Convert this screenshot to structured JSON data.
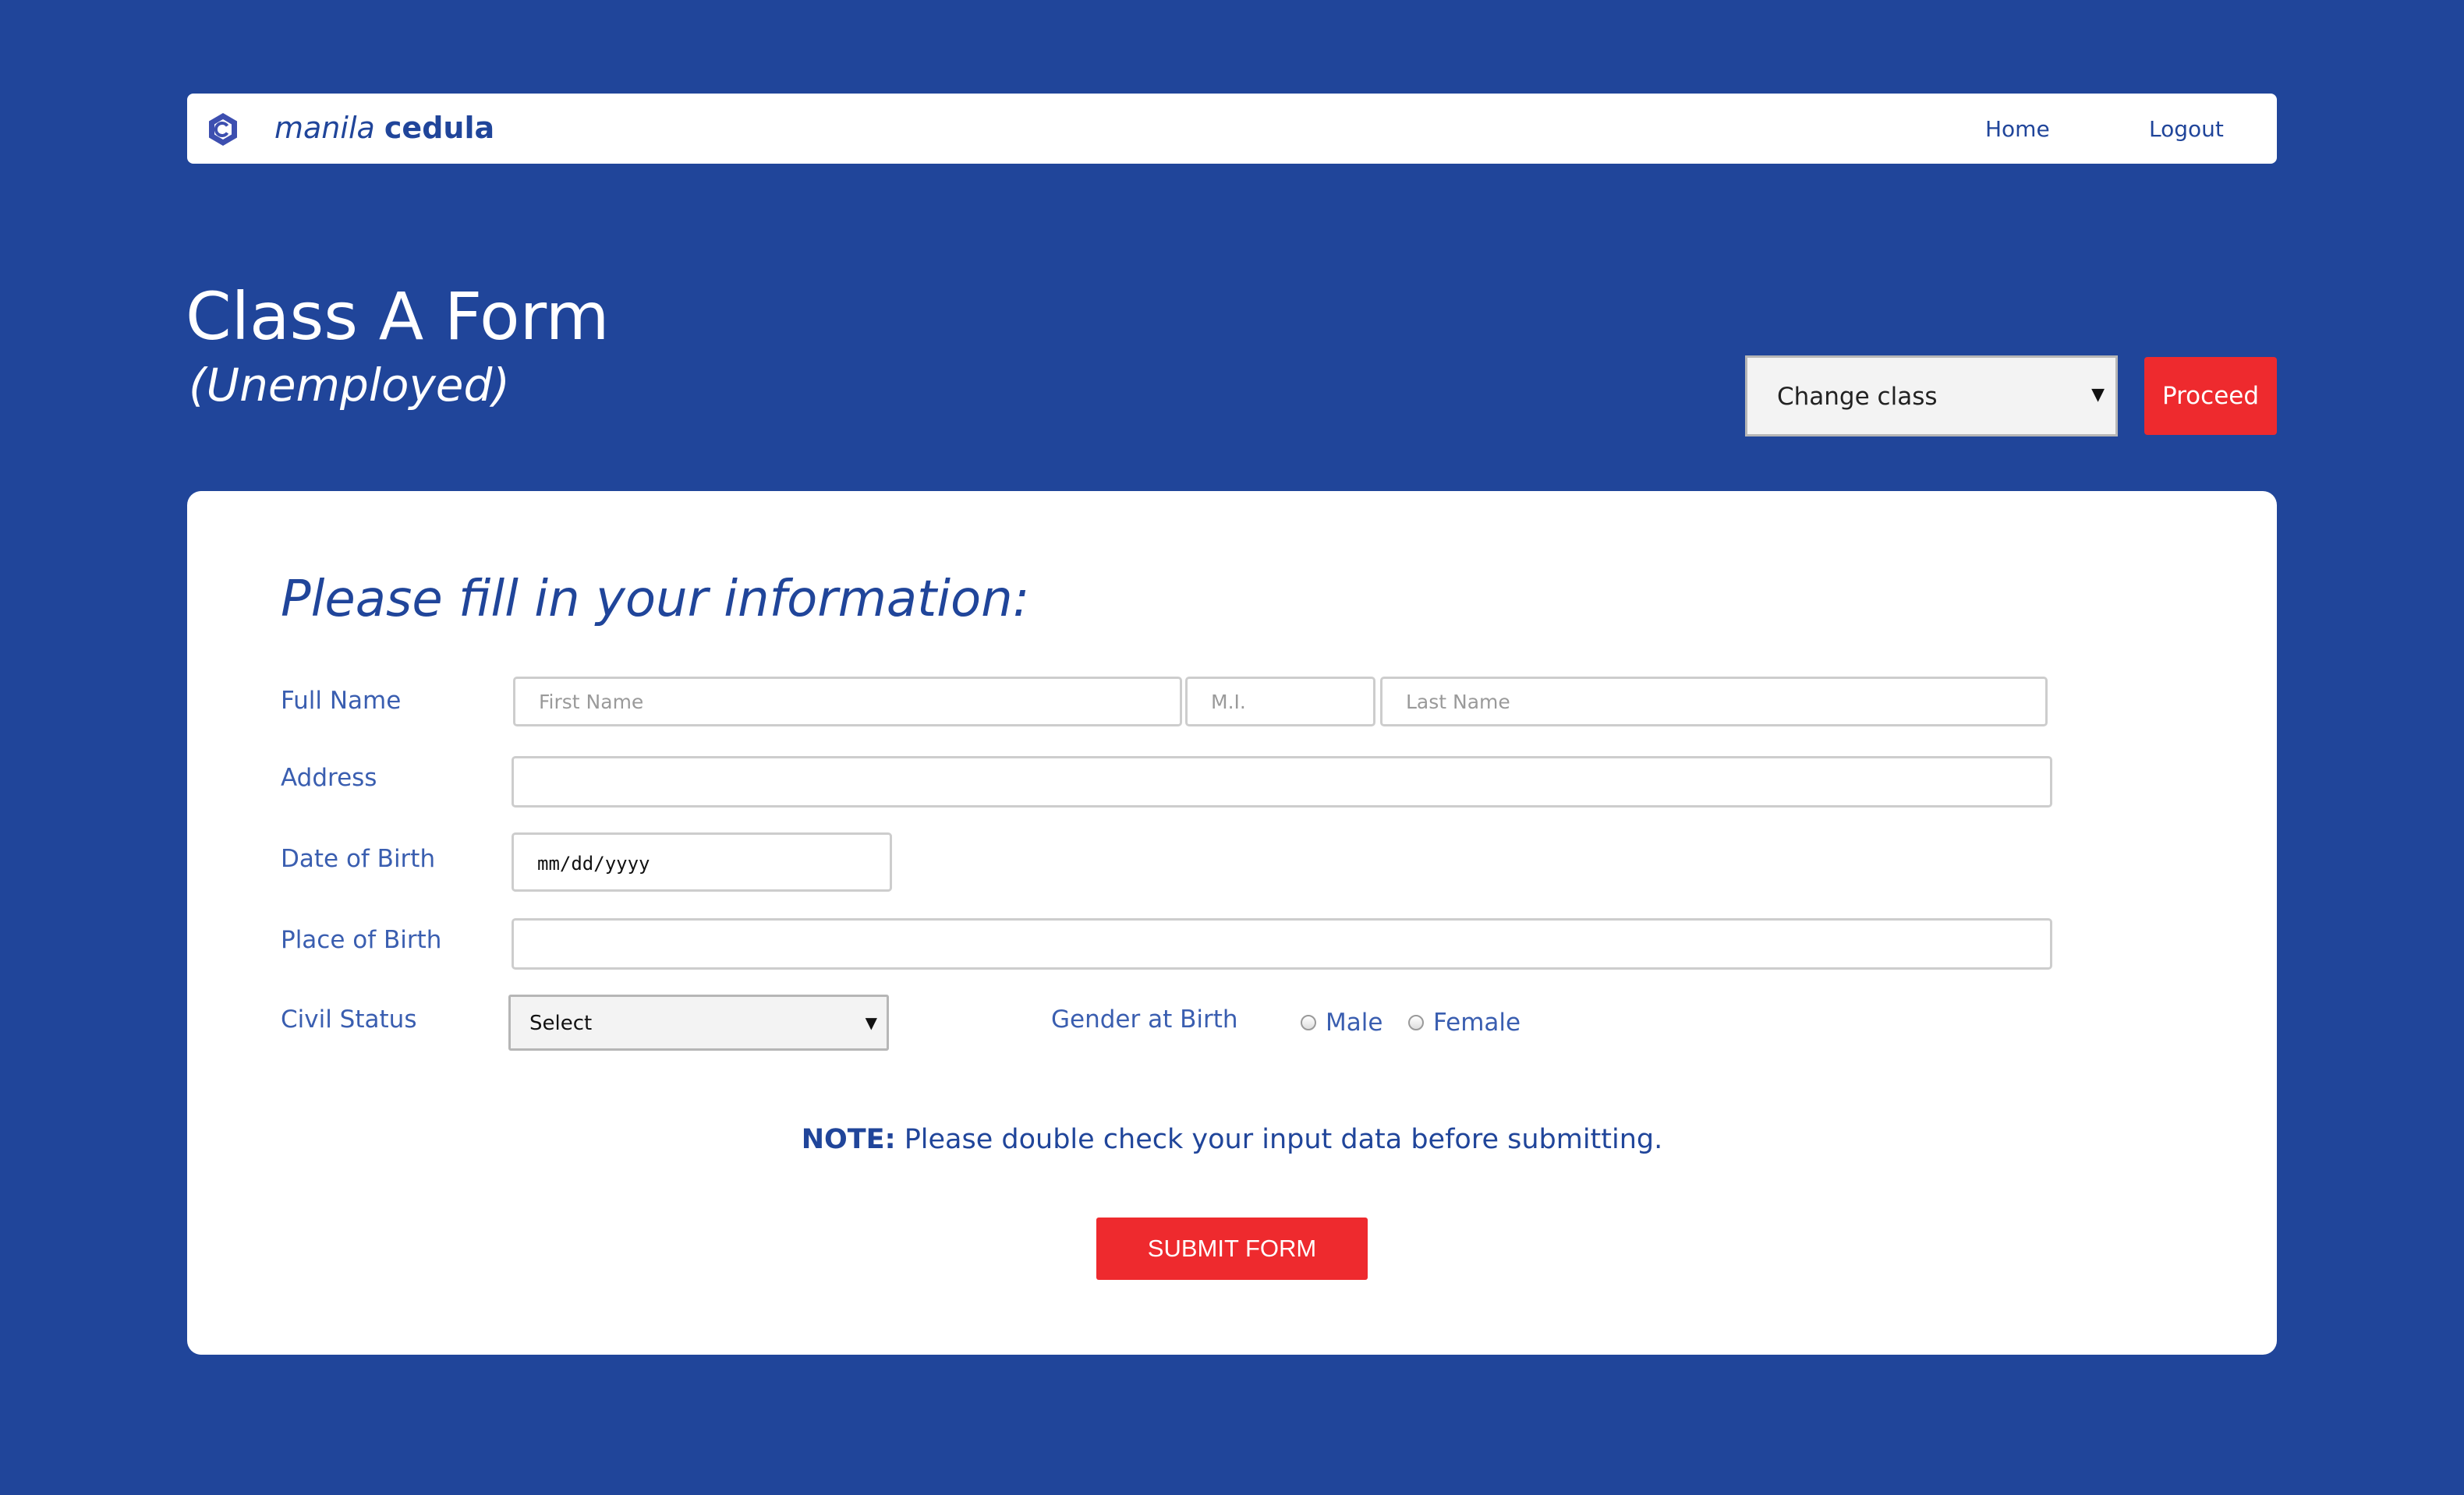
{
  "navbar": {
    "logo_icon": "hexagon-c-logo-icon",
    "brand_city": "manila",
    "brand_name": "cedula",
    "links": [
      "Home",
      "Logout"
    ]
  },
  "header": {
    "title": "Class A Form",
    "subtitle": "(Unemployed)",
    "class_select": "Change class",
    "proceed_label": "Proceed"
  },
  "form": {
    "heading": "Please fill in your information:",
    "full_name": {
      "label": "Full Name",
      "first_placeholder": "First Name",
      "mi_placeholder": "M.I.",
      "last_placeholder": "Last Name"
    },
    "address": {
      "label": "Address",
      "value": ""
    },
    "date_of_birth": {
      "label": "Date of Birth",
      "value": "mm/dd/yyyy"
    },
    "place_of_birth": {
      "label": "Place of Birth",
      "value": ""
    },
    "civil_status": {
      "label": "Civil Status",
      "selected": "Select"
    },
    "gender": {
      "label": "Gender at Birth",
      "options": [
        "Male",
        "Female"
      ]
    },
    "note_label": "NOTE:",
    "note_text": " Please double check your input data before submitting.",
    "submit_label": "SUBMIT FORM"
  },
  "colors": {
    "background": "#20459a",
    "accent_red": "#ee2a2e",
    "text_blue": "#3a5eb0",
    "card": "#ffffff"
  }
}
